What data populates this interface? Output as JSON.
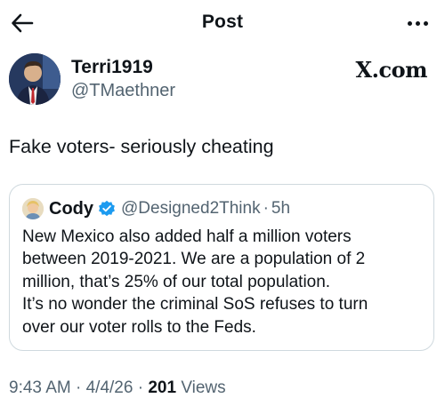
{
  "header": {
    "title": "Post",
    "back_icon": "arrow-left-icon",
    "more_icon": "more-horizontal-icon"
  },
  "author": {
    "name": "Terri1919",
    "handle": "@TMaethner"
  },
  "brand": "X.com",
  "post": {
    "text": "Fake voters- seriously cheating"
  },
  "quote": {
    "name": "Cody",
    "verified": true,
    "verified_color": "#1d9bf0",
    "handle": "@Designed2Think",
    "separator": "·",
    "time": "5h",
    "lines": [
      "New Mexico also added half a million voters",
      "between 2019-2021. We are a population of 2",
      "million, that’s 25% of our total population.",
      "It’s no wonder the criminal SoS refuses to turn",
      "over our voter rolls to the Feds."
    ]
  },
  "meta": {
    "time": "9:43 AM",
    "separator": "·",
    "date": "4/4/26",
    "views_count": "201",
    "views_label": "Views"
  },
  "colors": {
    "text": "#0f1419",
    "secondary": "#536471",
    "border": "#cfd9de"
  }
}
